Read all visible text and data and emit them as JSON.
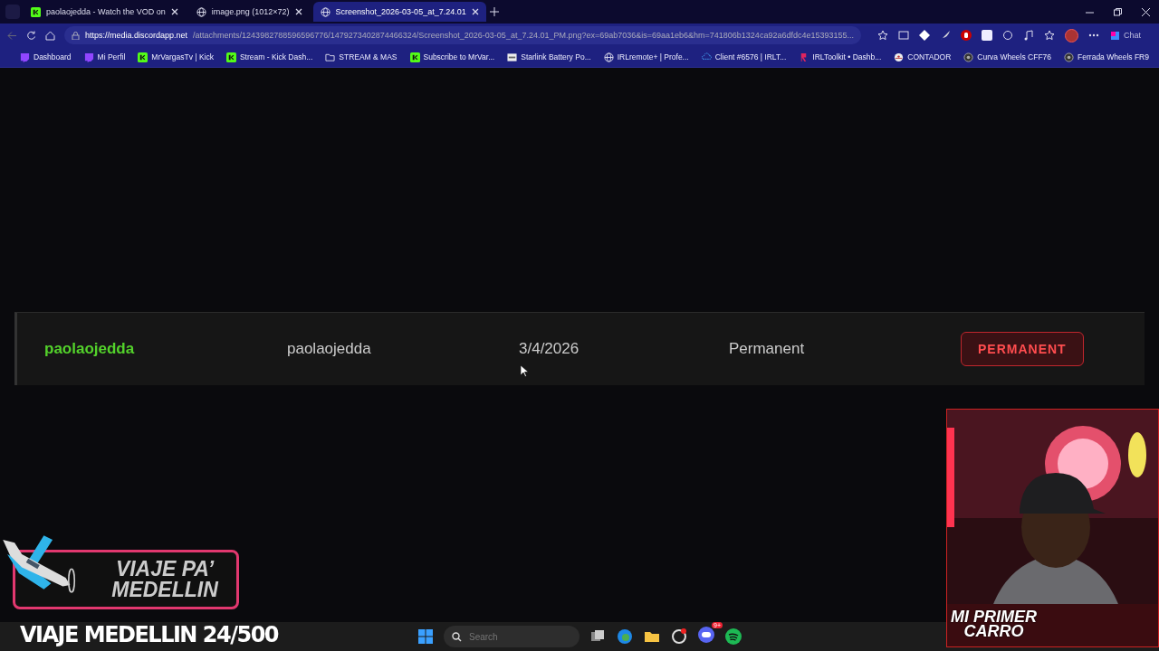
{
  "tabs": [
    {
      "title": "paolaojedda - Watch the VOD on",
      "kind": "square",
      "selected": false
    },
    {
      "title": "image.png (1012×72)",
      "kind": "globe",
      "selected": false
    },
    {
      "title": "Screenshot_2026-03-05_at_7.24.01",
      "kind": "globe",
      "selected": true
    }
  ],
  "address": {
    "host": "https://media.discordapp.net",
    "path": "/attachments/1243982788596596776/1479273402874466324/Screenshot_2026-03-05_at_7.24.01_PM.png?ex=69ab7036&is=69aa1eb6&hm=741806b1324ca92a6dfdc4e15393155..."
  },
  "toolbar": {
    "chat": "Chat"
  },
  "bookmarks": [
    {
      "label": "Dashboard",
      "kind": "chat"
    },
    {
      "label": "Mi Perfil",
      "kind": "chat"
    },
    {
      "label": "MrVargasTv | Kick",
      "kind": "square"
    },
    {
      "label": "Stream - Kick Dash...",
      "kind": "square"
    },
    {
      "label": "STREAM & MAS",
      "kind": "folder"
    },
    {
      "label": "Subscribe to MrVar...",
      "kind": "square"
    },
    {
      "label": "Starlink Battery Po...",
      "kind": "doc"
    },
    {
      "label": "IRLremote+ | Profe...",
      "kind": "globe"
    },
    {
      "label": "Client #6576 | IRLT...",
      "kind": "cloud"
    },
    {
      "label": "IRLToolkit • Dashb...",
      "kind": "mark"
    },
    {
      "label": "CONTADOR",
      "kind": "dial"
    },
    {
      "label": "Curva Wheels CFF76",
      "kind": "wheel"
    },
    {
      "label": "Ferrada Wheels FR9",
      "kind": "wheel"
    }
  ],
  "ban_row": {
    "user": "paolaojedda",
    "moderator": "paolaojedda",
    "date": "3/4/2026",
    "duration": "Permanent",
    "badge": "PERMANENT"
  },
  "overlay": {
    "title_line_1": "VIAJE PA’",
    "title_line_2": "MEDELLIN",
    "counter": "VIAJE MEDELLIN 24/500",
    "cam_caption_1": "MI PRIMER",
    "cam_caption_2": "CARRO"
  },
  "taskbar": {
    "search": {
      "placeholder": "Search"
    },
    "discord_badge": "9+"
  }
}
